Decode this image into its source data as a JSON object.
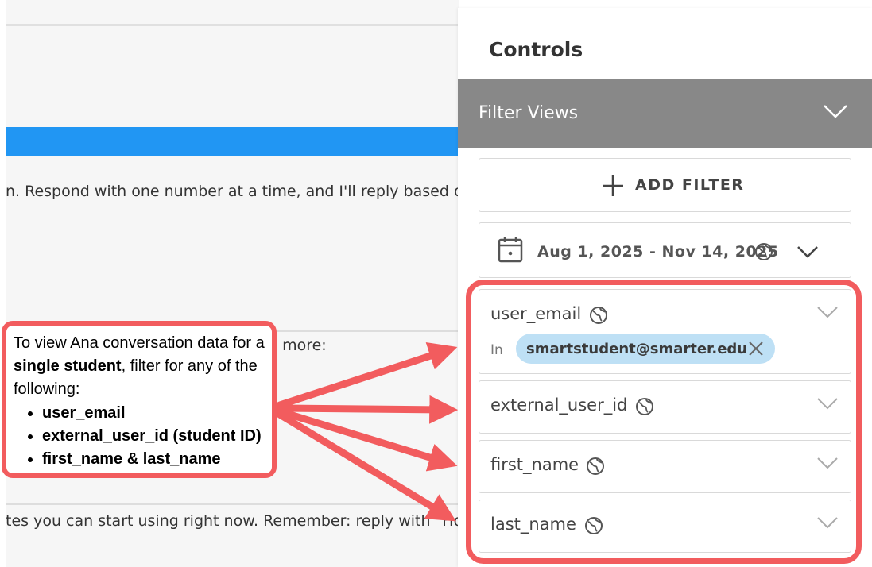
{
  "background": {
    "line_1": "n. Respond with one number at a time, and I'll reply based o",
    "line_2": "n more:",
    "line_3": "tes you can start using right now. Remember: reply with  \"Ho"
  },
  "panel": {
    "title": "Controls",
    "filter_views_label": "Filter Views",
    "add_filter_label": "ADD FILTER",
    "date_range": "Aug 1, 2025 - Nov 14, 2025",
    "fields": [
      {
        "label": "user_email",
        "operator": "In",
        "value": "smartstudent@smarter.edu"
      },
      {
        "label": "external_user_id"
      },
      {
        "label": "first_name"
      },
      {
        "label": "last_name"
      }
    ]
  },
  "callout": {
    "intro_prefix": "To view Ana conversation data for a ",
    "intro_bold": "single student",
    "intro_suffix": ", filter for any of the following:",
    "items": [
      "user_email",
      "external_user_id (student ID)",
      "first_name & last_name"
    ]
  },
  "colors": {
    "accent_red": "#f25c5e",
    "blue_bar": "#2196f3",
    "filter_views_bg": "#888888",
    "chip_bg": "#bee0f5"
  },
  "icons": [
    "plus-icon",
    "calendar-icon",
    "globe-icon",
    "chevron-down-icon",
    "close-icon"
  ]
}
